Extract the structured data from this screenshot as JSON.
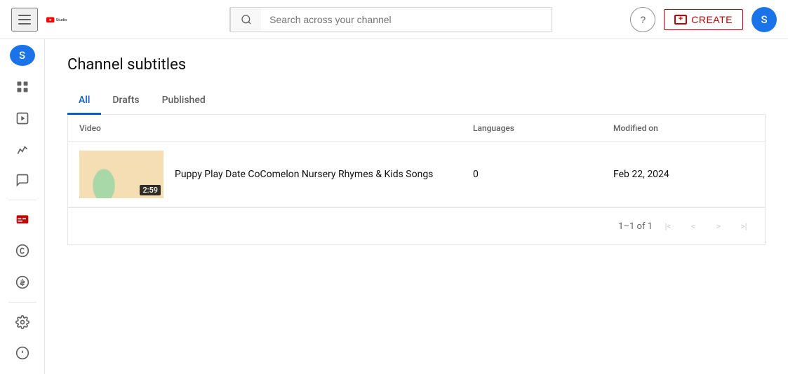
{
  "header": {
    "hamburger_label": "Menu",
    "logo_text": "Studio",
    "search_placeholder": "Search across your channel",
    "help_label": "?",
    "create_label": "CREATE",
    "avatar_letter": "S"
  },
  "sidebar": {
    "avatar_letter": "S",
    "items": [
      {
        "name": "dashboard",
        "label": "Dashboard"
      },
      {
        "name": "content",
        "label": "Content"
      },
      {
        "name": "analytics",
        "label": "Analytics"
      },
      {
        "name": "comments",
        "label": "Comments"
      },
      {
        "name": "subtitles",
        "label": "Subtitles",
        "active": true
      },
      {
        "name": "copyright",
        "label": "Copyright"
      },
      {
        "name": "monetization",
        "label": "Earn"
      },
      {
        "name": "settings",
        "label": "Settings"
      },
      {
        "name": "feedback",
        "label": "Feedback"
      }
    ]
  },
  "page": {
    "title": "Channel subtitles",
    "tabs": [
      {
        "id": "all",
        "label": "All",
        "active": true
      },
      {
        "id": "drafts",
        "label": "Drafts",
        "active": false
      },
      {
        "id": "published",
        "label": "Published",
        "active": false
      }
    ],
    "table": {
      "columns": {
        "video": "Video",
        "languages": "Languages",
        "modified": "Modified on"
      },
      "rows": [
        {
          "title": "Puppy Play Date CoComelon Nursery Rhymes & Kids Songs",
          "duration": "2:59",
          "languages": "0",
          "modified": "Feb 22, 2024"
        }
      ]
    },
    "pagination": {
      "info": "1–1 of 1",
      "first": "|<",
      "prev": "<",
      "next": ">",
      "last": ">|"
    }
  }
}
